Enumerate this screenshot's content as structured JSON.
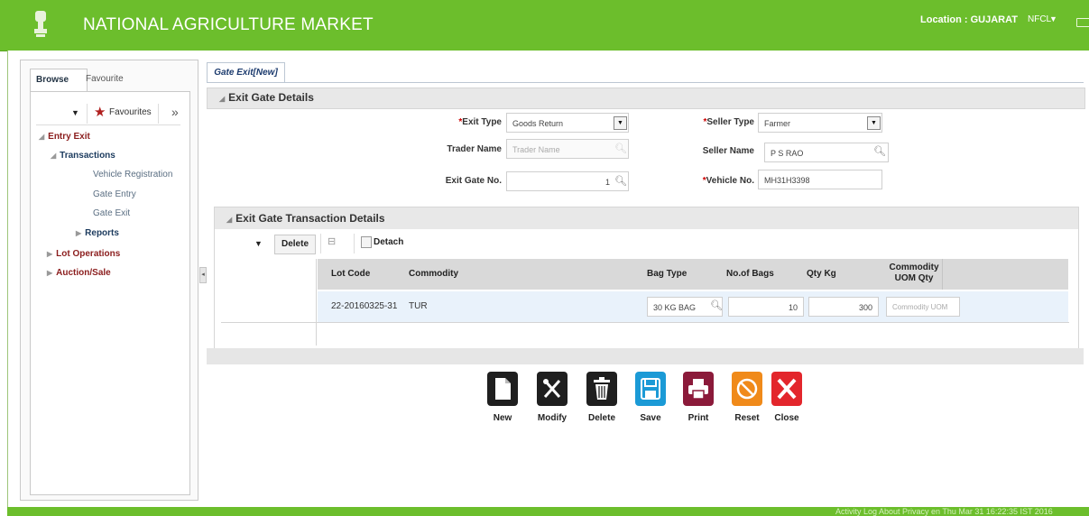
{
  "header": {
    "title": "NATIONAL AGRICULTURE MARKET",
    "location": "Location : GUJARAT",
    "user": "NFCL"
  },
  "left_panel": {
    "tabs": [
      "Browse",
      "Favourite"
    ],
    "favourites_label": "Favourites",
    "tree": {
      "entry_exit": "Entry Exit",
      "transactions": "Transactions",
      "vehicle_registration": "Vehicle Registration",
      "gate_entry": "Gate Entry",
      "gate_exit": "Gate Exit",
      "reports": "Reports",
      "lot_operations": "Lot Operations",
      "auction_sale": "Auction/Sale"
    }
  },
  "main": {
    "tab": "Gate Exit[New]",
    "section1_title": "Exit Gate Details",
    "fields": {
      "exit_type_label": "Exit Type",
      "exit_type_value": "Goods Return",
      "seller_type_label": "Seller Type",
      "seller_type_value": "Farmer",
      "trader_name_label": "Trader Name",
      "trader_name_placeholder": "Trader Name",
      "seller_name_label": "Seller Name",
      "seller_name_value": "P S RAO",
      "exit_gate_no_label": "Exit Gate No.",
      "exit_gate_no_value": "1",
      "vehicle_no_label": "Vehicle No.",
      "vehicle_no_value": "MH31H3398"
    },
    "section2_title": "Exit Gate Transaction Details",
    "toolbar": {
      "delete": "Delete",
      "detach": "Detach"
    },
    "grid": {
      "columns": [
        "Lot Code",
        "Commodity",
        "Bag Type",
        "No.of Bags",
        "Qty Kg",
        "Commodity UOM Qty"
      ],
      "rows": [
        {
          "lot_code": "22-20160325-31",
          "commodity": "TUR",
          "bag_type": "30 KG BAG",
          "no_of_bags": "10",
          "qty_kg": "300",
          "uom_qty_placeholder": "Commodity UOM"
        }
      ]
    }
  },
  "actions": [
    "New",
    "Modify",
    "Delete",
    "Save",
    "Print",
    "Reset",
    "Close"
  ],
  "footer": "Activity Log   About   Privacy   en   Thu Mar 31 16:22:35 IST 2016",
  "colors": {
    "header_green": "#6cbe2c",
    "new": "#1f1f1f",
    "modify": "#1f1f1f",
    "delete": "#1f1f1f",
    "save": "#1b9ad6",
    "print": "#8b1a3a",
    "reset": "#f08a1a",
    "close": "#e3262c"
  }
}
